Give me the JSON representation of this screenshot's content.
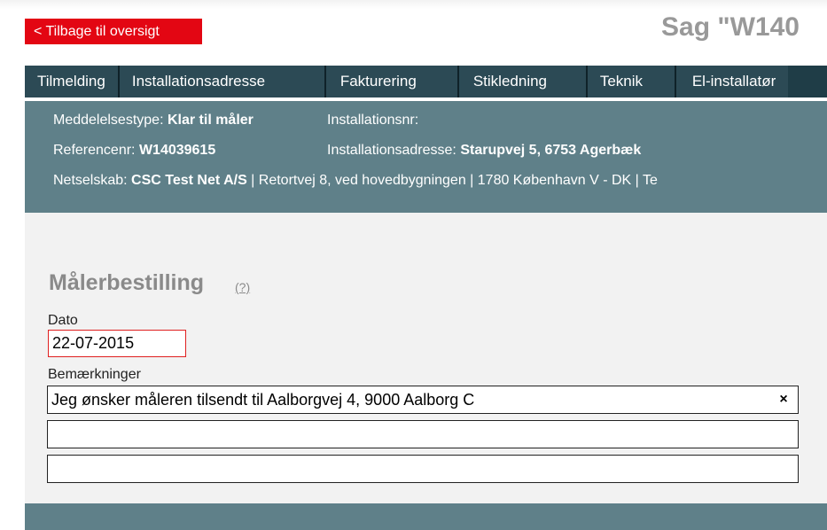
{
  "header": {
    "back_label": "< Tilbage til oversigt",
    "case_title": "Sag \"W140"
  },
  "tabs": [
    {
      "label": "Tilmelding"
    },
    {
      "label": "Installationsadresse"
    },
    {
      "label": "Fakturering"
    },
    {
      "label": "Stikledning"
    },
    {
      "label": "Teknik"
    },
    {
      "label": "El-installatør"
    }
  ],
  "info": {
    "meddelelsestype_label": "Meddelelsestype: ",
    "meddelelsestype_value": "Klar til måler",
    "installationsnr_label": "Installationsnr:",
    "referencenr_label": "Referencenr: ",
    "referencenr_value": "W14039615",
    "installationsadresse_label": "Installationsadresse: ",
    "installationsadresse_value": "Starupvej 5, 6753 Agerbæk",
    "netselskab_label": "Netselskab: ",
    "netselskab_value": "CSC Test Net A/S",
    "netselskab_rest": " | Retortvej 8, ved hovedbygningen | 1780 København V - DK | Te"
  },
  "form": {
    "section_title": "Målerbestilling",
    "help_label": "(?)",
    "dato_label": "Dato",
    "dato_value": "22-07-2015",
    "remarks_label": "Bemærkninger",
    "remark_1": "Jeg ønsker måleren tilsendt til Aalborgvej 4, 9000 Aalborg C",
    "remark_2": "",
    "remark_3": "",
    "clear_symbol": "×"
  }
}
